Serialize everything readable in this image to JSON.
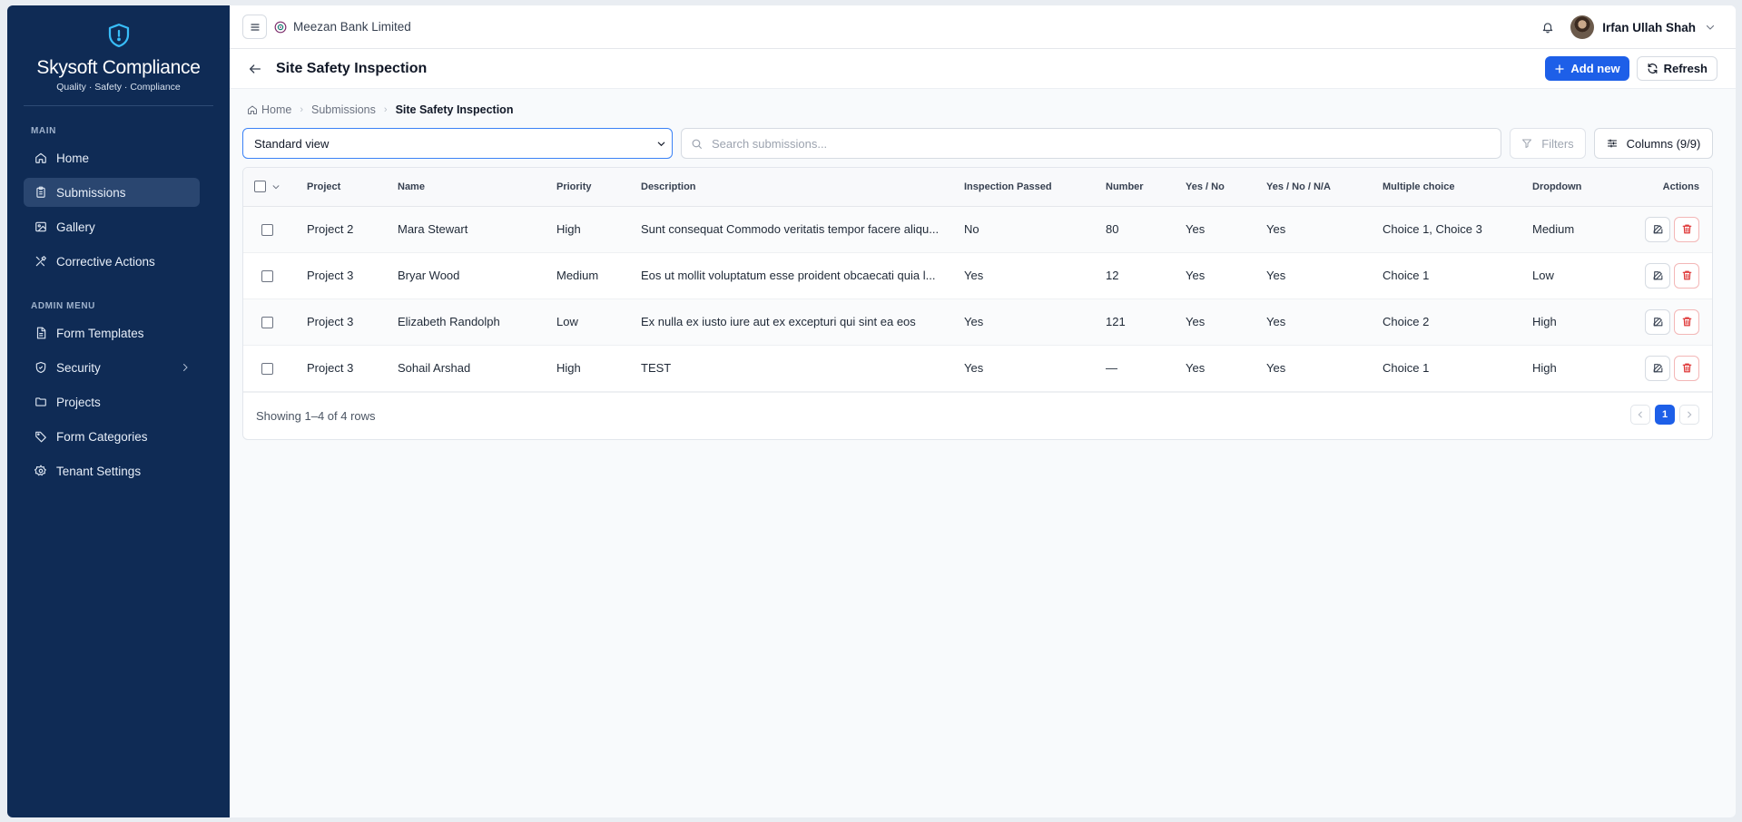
{
  "sidebar": {
    "brand_title": "Skysoft Compliance",
    "brand_subtitle": "Quality · Safety · Compliance",
    "section_main": "MAIN",
    "section_admin": "ADMIN MENU",
    "main_items": [
      {
        "label": "Home",
        "icon": "home-icon"
      },
      {
        "label": "Submissions",
        "icon": "clipboard-icon",
        "active": true
      },
      {
        "label": "Gallery",
        "icon": "image-icon"
      },
      {
        "label": "Corrective Actions",
        "icon": "tools-icon"
      }
    ],
    "admin_items": [
      {
        "label": "Form Templates",
        "icon": "file-icon"
      },
      {
        "label": "Security",
        "icon": "shield-icon"
      },
      {
        "label": "Projects",
        "icon": "folder-icon"
      },
      {
        "label": "Form Categories",
        "icon": "tag-icon"
      },
      {
        "label": "Tenant Settings",
        "icon": "gear-icon"
      }
    ]
  },
  "topbar": {
    "tenant": "Meezan Bank Limited",
    "user": "Irfan Ullah Shah"
  },
  "page": {
    "title": "Site Safety Inspection",
    "add_label": "Add new",
    "refresh_label": "Refresh"
  },
  "breadcrumb": {
    "home": "Home",
    "submissions": "Submissions",
    "current": "Site Safety Inspection"
  },
  "toolbar": {
    "view": "Standard view",
    "search_placeholder": "Search submissions...",
    "filters": "Filters",
    "columns": "Columns (9/9)"
  },
  "table": {
    "headers": [
      "Project",
      "Name",
      "Priority",
      "Description",
      "Inspection Passed",
      "Number",
      "Yes / No",
      "Yes / No / N/A",
      "Multiple choice",
      "Dropdown",
      "Actions"
    ],
    "rows": [
      [
        "Project 2",
        "Mara Stewart",
        "High",
        "Sunt consequat Commodo veritatis tempor facere aliqu...",
        "No",
        "80",
        "Yes",
        "Yes",
        "Choice 1, Choice 3",
        "Medium"
      ],
      [
        "Project 3",
        "Bryar Wood",
        "Medium",
        "Eos ut mollit voluptatum esse proident obcaecati quia l...",
        "Yes",
        "12",
        "Yes",
        "Yes",
        "Choice 1",
        "Low"
      ],
      [
        "Project 3",
        "Elizabeth Randolph",
        "Low",
        "Ex nulla ex iusto iure aut ex excepturi qui sint ea eos",
        "Yes",
        "121",
        "Yes",
        "Yes",
        "Choice 2",
        "High"
      ],
      [
        "Project 3",
        "Sohail Arshad",
        "High",
        "TEST",
        "Yes",
        "—",
        "Yes",
        "Yes",
        "Choice 1",
        "High"
      ]
    ],
    "summary": "Showing 1–4 of 4 rows",
    "current_page": "1"
  },
  "colors": {
    "sidebar": "#0f2b55",
    "accent": "#1d5fe8",
    "danger": "#dc2626"
  }
}
